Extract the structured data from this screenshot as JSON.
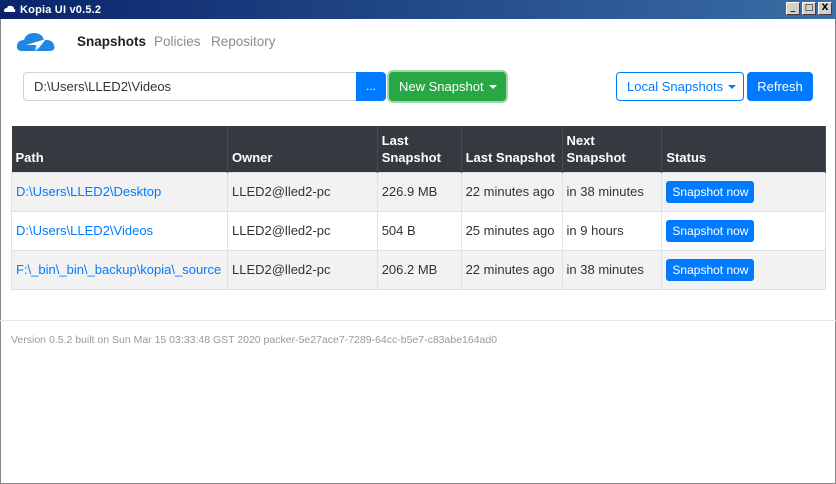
{
  "window": {
    "title": "Kopia UI v0.5.2",
    "minimize": "_",
    "maximize": "□",
    "close": "X"
  },
  "nav": {
    "items": [
      {
        "label": "Snapshots",
        "active": true
      },
      {
        "label": "Policies",
        "active": false
      },
      {
        "label": "Repository",
        "active": false
      }
    ]
  },
  "controls": {
    "path_value": "D:\\Users\\LLED2\\Videos",
    "browse_label": "...",
    "new_snapshot_label": "New Snapshot",
    "local_snapshots_label": "Local Snapshots",
    "refresh_label": "Refresh"
  },
  "table": {
    "headers": [
      "Path",
      "Owner",
      "Last Snapshot",
      "Last Snapshot",
      "Next Snapshot",
      "Status"
    ],
    "rows": [
      {
        "path": "D:\\Users\\LLED2\\Desktop",
        "owner": "LLED2@lled2-pc",
        "size": "226.9 MB",
        "last": "22 minutes ago",
        "next": "in 38 minutes",
        "action": "Snapshot now"
      },
      {
        "path": "D:\\Users\\LLED2\\Videos",
        "owner": "LLED2@lled2-pc",
        "size": "504 B",
        "last": "25 minutes ago",
        "next": "in 9 hours",
        "action": "Snapshot now"
      },
      {
        "path": "F:\\_bin\\_bin\\_backup\\kopia\\_source",
        "owner": "LLED2@lled2-pc",
        "size": "206.2 MB",
        "last": "22 minutes ago",
        "next": "in 38 minutes",
        "action": "Snapshot now"
      }
    ]
  },
  "footer": {
    "version_text": "Version 0.5.2 built on Sun Mar 15 03:33:48 GST 2020 packer-5e27ace7-7289-64cc-b5e7-c83abe164ad0"
  },
  "colors": {
    "primary": "#007bff",
    "success": "#28a745",
    "table_header": "#343a40"
  }
}
